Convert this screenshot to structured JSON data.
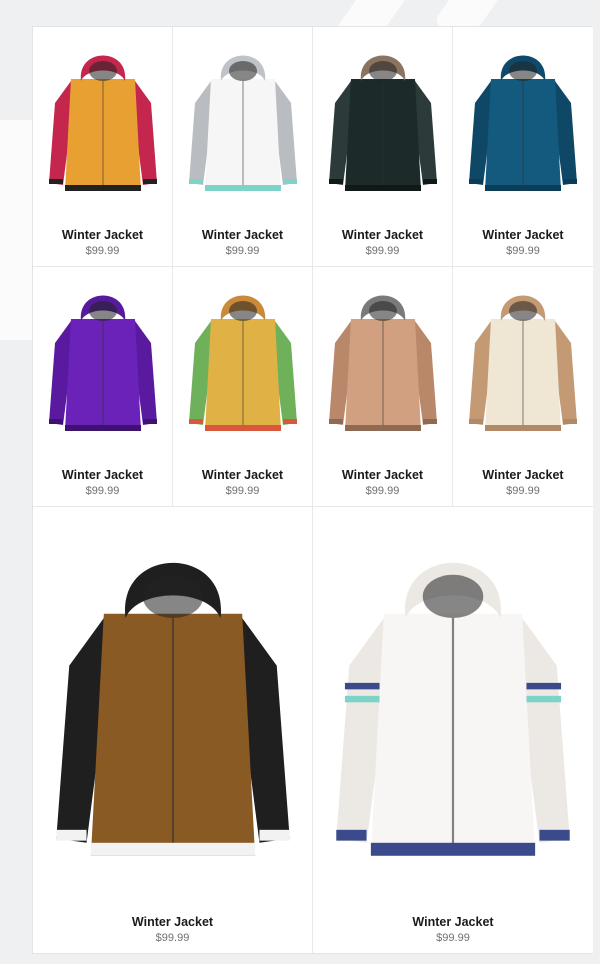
{
  "products": [
    {
      "name": "Winter Jacket",
      "price": "$99.99",
      "image": "orange-red-hooded-snowboard-jacket",
      "colors": {
        "body": "#e8a032",
        "accent": "#c4264d",
        "hood": "#c4264d",
        "trim": "#222222"
      }
    },
    {
      "name": "Winter Jacket",
      "price": "$99.99",
      "image": "white-grey-hooded-puffer-jacket",
      "colors": {
        "body": "#f6f6f6",
        "accent": "#b9bcc0",
        "hood": "#bfc2c6",
        "trim": "#7ed3c9"
      }
    },
    {
      "name": "Winter Jacket",
      "price": "$99.99",
      "image": "black-fur-hood-parka",
      "colors": {
        "body": "#1c2a2a",
        "accent": "#2c3a3a",
        "hood": "#8a7460",
        "trim": "#111818"
      }
    },
    {
      "name": "Winter Jacket",
      "price": "$99.99",
      "image": "teal-blue-hooded-jacket",
      "colors": {
        "body": "#145a7e",
        "accent": "#0e4866",
        "hood": "#0f4a6a",
        "trim": "#0c3d57"
      }
    },
    {
      "name": "Winter Jacket",
      "price": "$99.99",
      "image": "purple-hooded-ski-jacket",
      "colors": {
        "body": "#6a22b8",
        "accent": "#5a1aa0",
        "hood": "#561b9a",
        "trim": "#3d1270"
      }
    },
    {
      "name": "Winter Jacket",
      "price": "$99.99",
      "image": "striped-multicolor-hooded-jacket",
      "colors": {
        "body": "#e0b144",
        "accent": "#6fb05a",
        "hood": "#c98b3a",
        "trim": "#d9573c"
      }
    },
    {
      "name": "Winter Jacket",
      "price": "$99.99",
      "image": "tan-patterned-hooded-jacket",
      "colors": {
        "body": "#d1a080",
        "accent": "#b9876a",
        "hood": "#7a7a7a",
        "trim": "#8e6a52"
      }
    },
    {
      "name": "Winter Jacket",
      "price": "$99.99",
      "image": "cream-tan-sleeve-hooded-jacket",
      "colors": {
        "body": "#efe7d3",
        "accent": "#c39a73",
        "hood": "#c39a73",
        "trim": "#b08a66"
      }
    }
  ],
  "featured": [
    {
      "name": "Winter Jacket",
      "price": "$99.99",
      "image": "brown-black-varsity-hooded-jacket",
      "colors": {
        "body": "#8a5a24",
        "accent": "#1f1f1f",
        "hood": "#1f1f1f",
        "trim": "#f2f2f2"
      }
    },
    {
      "name": "Winter Jacket",
      "price": "$99.99",
      "image": "white-quilted-jacket-striped-sleeves",
      "colors": {
        "body": "#f8f6f4",
        "accent": "#ece8e4",
        "hood": "#ece8e4",
        "trim": "#3b4a8a"
      }
    }
  ]
}
